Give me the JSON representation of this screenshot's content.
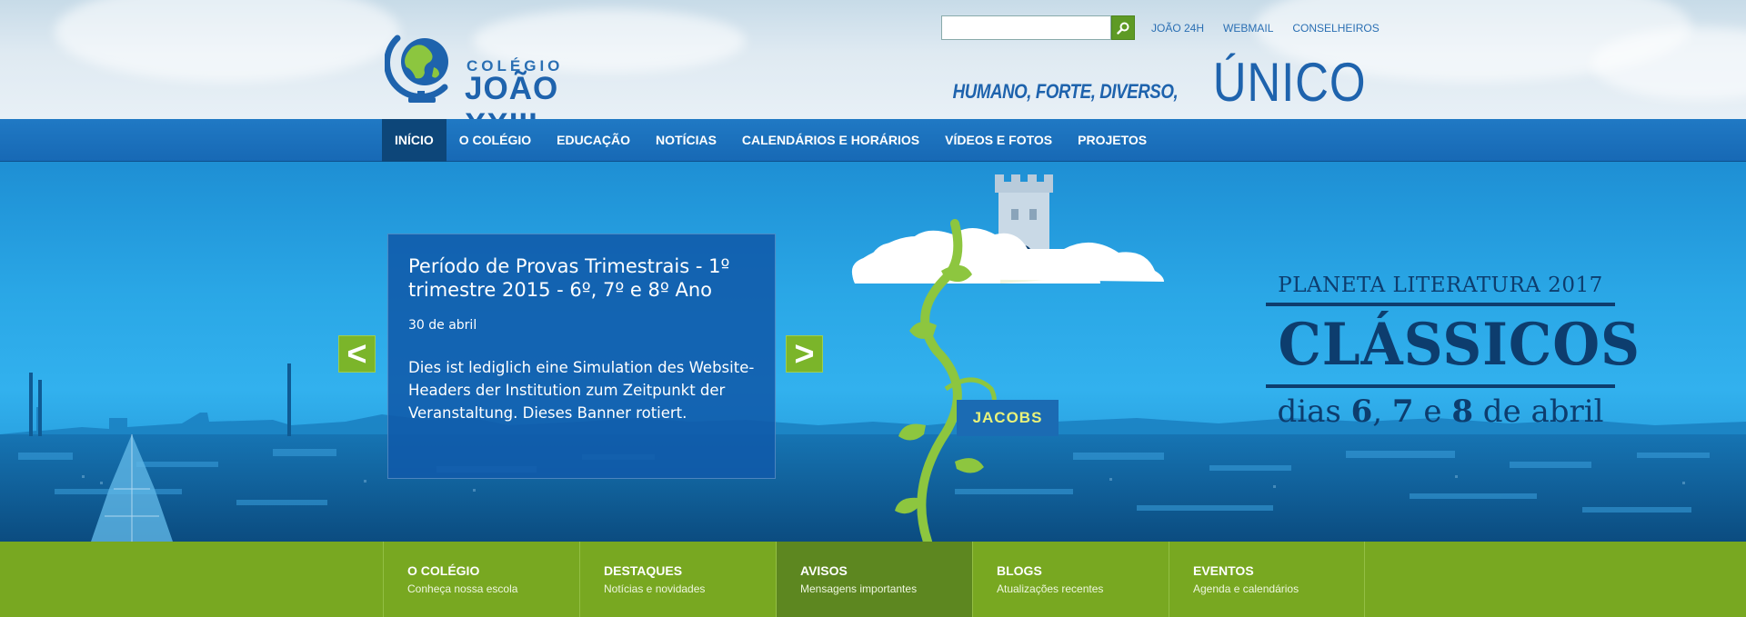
{
  "header": {
    "logo_small": "COLÉGIO",
    "logo_big": "JOÃO XXIII",
    "search_placeholder": "",
    "search_value": "",
    "top_links": [
      "JOÃO 24H",
      "WEBMAIL",
      "CONSELHEIROS"
    ],
    "tagline_small": "HUMANO, FORTE, DIVERSO,",
    "tagline_big": "ÚNICO"
  },
  "nav": {
    "items": [
      "INÍCIO",
      "O COLÉGIO",
      "EDUCAÇÃO",
      "NOTÍCIAS",
      "CALENDÁRIOS E HORÁRIOS",
      "VÍDEOS E FOTOS",
      "PROJETOS"
    ],
    "active": "INÍCIO"
  },
  "slide": {
    "title": "Período de Provas Trimestrais - 1º trimestre 2015 - 6º, 7º e 8º Ano",
    "date": "30 de abril",
    "text": "Dies ist lediglich eine Simulation des Website-Headers der Institution zum Zeitpunkt der Veranstaltung. Dieses Banner rotiert.",
    "prev_label": "<",
    "next_label": ">"
  },
  "promo": {
    "top": "PLANETA LITERATURA 2017",
    "headline": "CLÁSSICOS",
    "bottom_pre": "dias ",
    "bottom_d1": "6",
    "bottom_sep1": ", ",
    "bottom_d2": "7",
    "bottom_sep2": " e ",
    "bottom_d3": "8",
    "bottom_post": " de abril",
    "sign": "JACOBS"
  },
  "tiles": [
    {
      "title": "O COLÉGIO",
      "sub": "Conheça nossa escola"
    },
    {
      "title": "DESTAQUES",
      "sub": "Notícias e novidades"
    },
    {
      "title": "AVISOS",
      "sub": "Mensagens importantes"
    },
    {
      "title": "BLOGS",
      "sub": "Atualizações recentes"
    },
    {
      "title": "EVENTOS",
      "sub": "Agenda e calendários"
    }
  ],
  "colors": {
    "brand_blue": "#1769b5",
    "nav_active": "#0d4679",
    "green": "#78a821",
    "promo_text": "#0d3d6e"
  }
}
